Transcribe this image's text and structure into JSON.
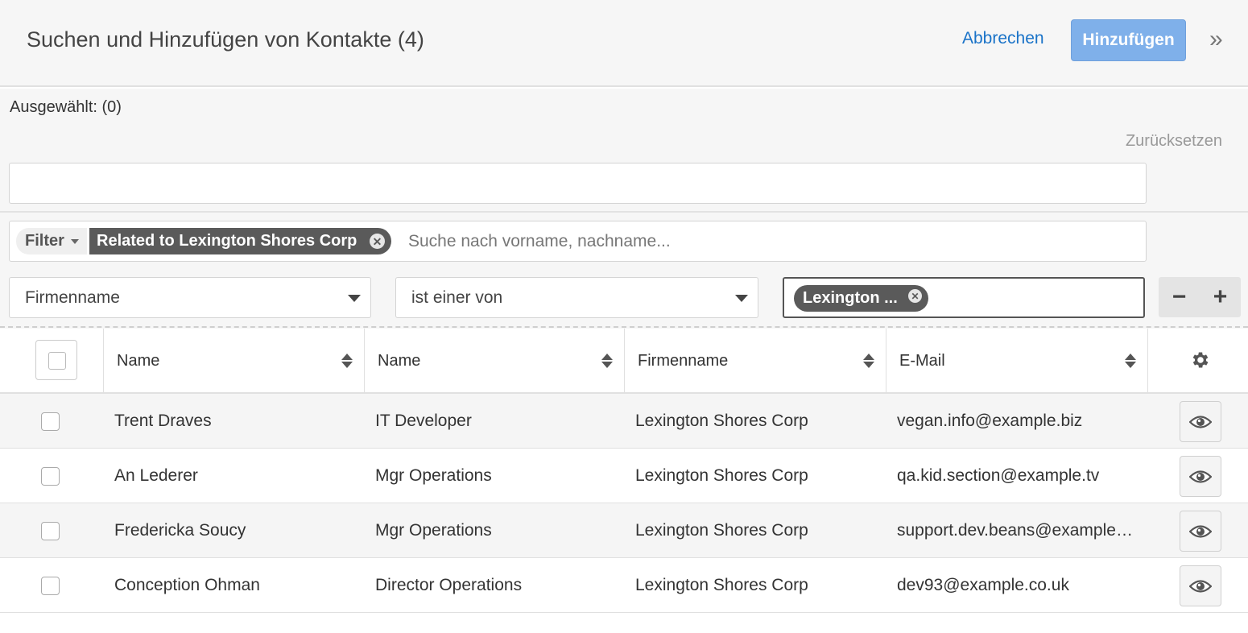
{
  "header": {
    "title": "Suchen und Hinzufügen von Kontakte (4)",
    "cancel_label": "Abbrechen",
    "add_label": "Hinzufügen",
    "expand_glyph": "»"
  },
  "selection": {
    "selected_label": "Ausgewählt: (0)",
    "reset_label": "Zurücksetzen"
  },
  "filter": {
    "filter_label": "Filter",
    "chip_label": "Related to Lexington Shores Corp",
    "search_placeholder": "Suche nach vorname, nachname...",
    "field_select": "Firmenname",
    "operator_select": "ist einer von",
    "value_chip": "Lexington ...",
    "remove_symbol": "−",
    "add_symbol": "+"
  },
  "table": {
    "columns": [
      "Name",
      "Name",
      "Firmenname",
      "E-Mail"
    ],
    "rows": [
      {
        "name": "Trent Draves",
        "title": "IT Developer",
        "company": "Lexington Shores Corp",
        "email": "vegan.info@example.biz"
      },
      {
        "name": "An Lederer",
        "title": "Mgr Operations",
        "company": "Lexington Shores Corp",
        "email": "qa.kid.section@example.tv"
      },
      {
        "name": "Fredericka Soucy",
        "title": "Mgr Operations",
        "company": "Lexington Shores Corp",
        "email": "support.dev.beans@example.com"
      },
      {
        "name": "Conception Ohman",
        "title": "Director Operations",
        "company": "Lexington Shores Corp",
        "email": "dev93@example.co.uk"
      }
    ]
  },
  "icons": {
    "chip_remove": "close-icon",
    "settings": "gear-icon",
    "preview": "eye-icon",
    "sort": "sort-icon"
  },
  "colors": {
    "accent_link": "#1a73c8",
    "primary_button": "#7fb0ea",
    "chip_bg": "#5a5a5a"
  }
}
